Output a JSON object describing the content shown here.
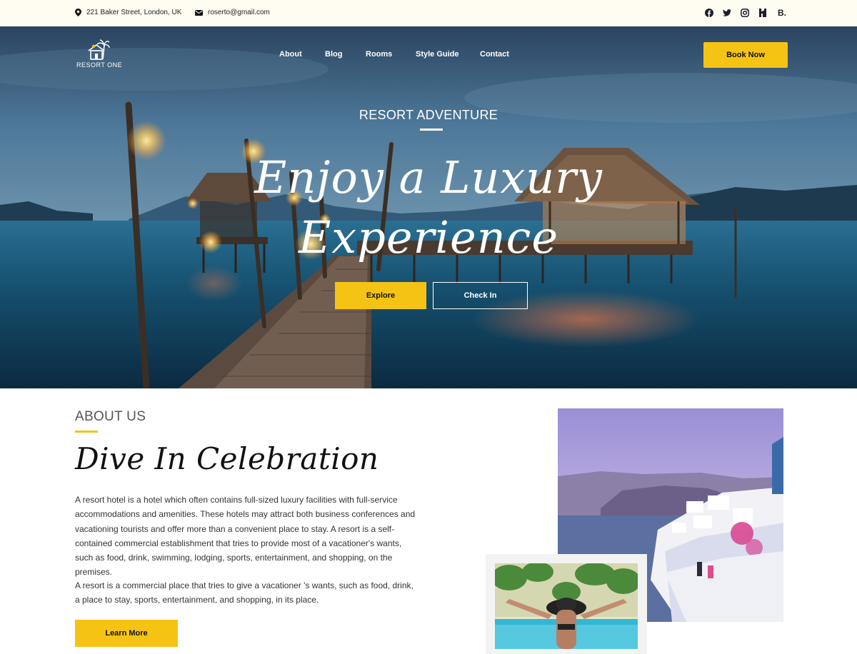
{
  "topbar": {
    "address": "221 Baker Street, London, UK",
    "email": "roserto@gmail.com",
    "socials": [
      {
        "name": "facebook",
        "glyph": "f"
      },
      {
        "name": "twitter",
        "glyph": ""
      },
      {
        "name": "instagram",
        "glyph": ""
      },
      {
        "name": "houzz",
        "glyph": "H"
      },
      {
        "name": "behance",
        "glyph": "B."
      }
    ]
  },
  "header": {
    "logo_text": "RESORT ONE",
    "nav": [
      "About",
      "Blog",
      "Rooms",
      "Style Guide",
      "Contact"
    ],
    "book_label": "Book Now"
  },
  "hero": {
    "subtitle": "RESORT ADVENTURE",
    "title_line1": "Enjoy a Luxury",
    "title_line2": "Experience",
    "explore_label": "Explore",
    "checkin_label": "Check In"
  },
  "about": {
    "label": "ABOUT US",
    "title": "Dive In Celebration",
    "paragraph1": "A resort hotel is a hotel which often contains full-sized luxury facilities with full-service accommodations and amenities. These hotels may attract both business conferences and vacationing tourists and offer more than a convenient place to stay. A resort is a self-contained commercial establishment that tries to provide most of a vacationer's wants, such as food, drink, swimming, lodging, sports, entertainment, and shopping, on the premises.",
    "paragraph2": "A resort is a commercial place that tries to give a vacationer 's wants, such as food, drink, a place to stay, sports, entertainment, and shopping, in its place.",
    "learn_label": "Learn More"
  },
  "colors": {
    "accent": "#f5c313",
    "topbar_bg": "#fffcf2"
  }
}
